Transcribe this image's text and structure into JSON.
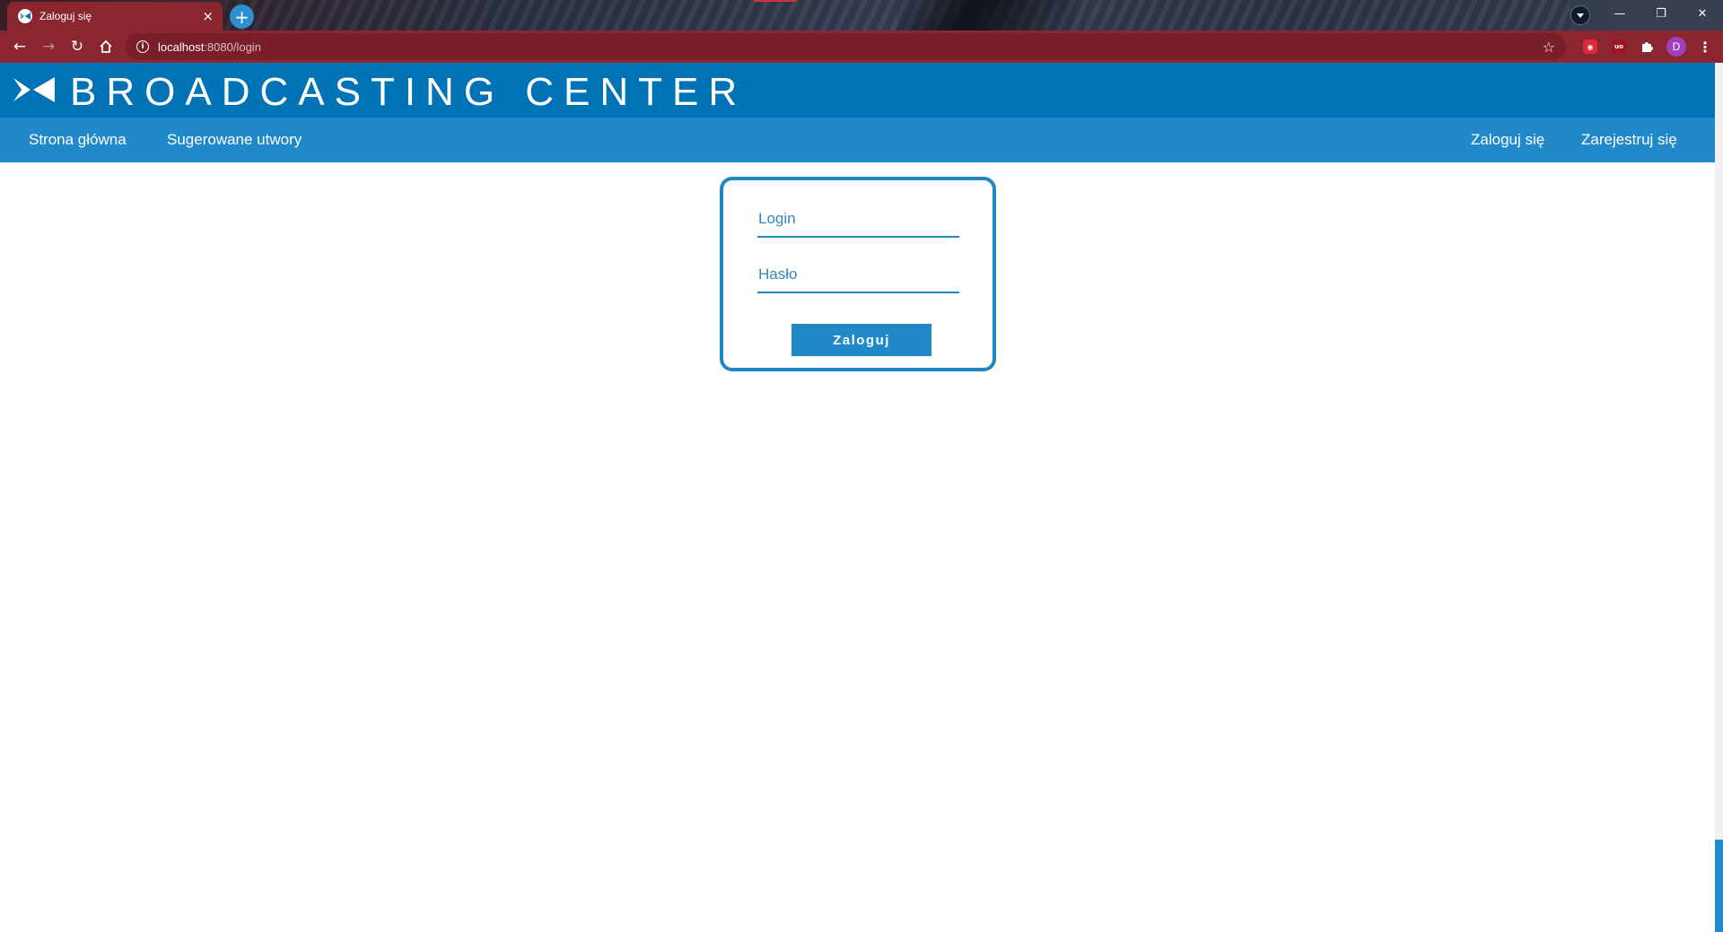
{
  "browser": {
    "tab_title": "Zaloguj się",
    "newtab_glyph": "+",
    "url_host": "localhost",
    "url_rest": ":8080/login",
    "profile_initial": "D",
    "window_controls": {
      "minimize": "—",
      "restore": "❐",
      "close": "✕"
    },
    "accent_color": "#8a2630"
  },
  "site": {
    "title": "BROADCASTING CENTER",
    "header_color": "#0073b7",
    "nav_color": "#2189c9",
    "nav_left": [
      {
        "label": "Strona główna"
      },
      {
        "label": "Sugerowane utwory"
      }
    ],
    "nav_right": [
      {
        "label": "Zaloguj się"
      },
      {
        "label": "Zarejestruj się"
      }
    ]
  },
  "login_form": {
    "login_placeholder": "Login",
    "password_placeholder": "Hasło",
    "submit_label": "Zaloguj"
  }
}
